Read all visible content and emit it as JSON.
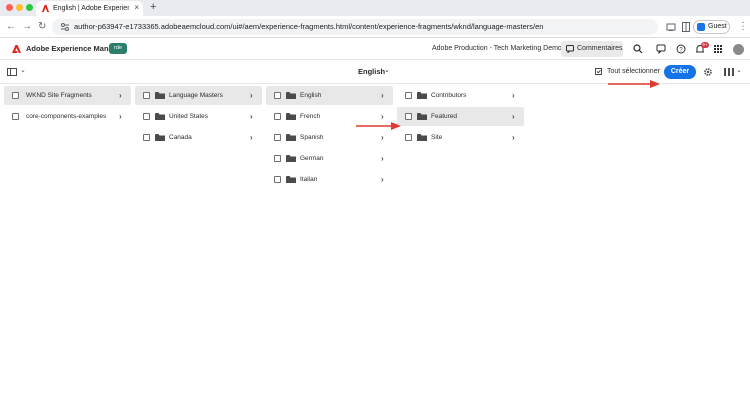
{
  "browser": {
    "tab_title": "English | Adobe Experience M",
    "url": "author-p63947-e1733365.adobeaemcloud.com/ui#/aem/experience-fragments.html/content/experience-fragments/wknd/language-masters/en",
    "guest_label": "Guest",
    "new_tab": "+",
    "close": "×"
  },
  "header": {
    "app_name": "Adobe Experience Manager",
    "env_badge": "rde",
    "org_name": "Adobe Production - Tech Marketing Demos",
    "comments_label": "Commentaires",
    "notification_count": "9+"
  },
  "actionbar": {
    "title": "English",
    "select_all_label": "Tout sélectionner",
    "create_label": "Créer"
  },
  "columns": [
    {
      "items": [
        {
          "label": "WKND Site Fragments",
          "folder": false,
          "chevron": true,
          "active": true
        },
        {
          "label": "core-components-examples",
          "folder": false,
          "chevron": true,
          "active": false
        }
      ]
    },
    {
      "items": [
        {
          "label": "Language Masters",
          "folder": true,
          "chevron": true,
          "active": true
        },
        {
          "label": "United States",
          "folder": true,
          "chevron": true,
          "active": false
        },
        {
          "label": "Canada",
          "folder": true,
          "chevron": true,
          "active": false
        }
      ]
    },
    {
      "items": [
        {
          "label": "English",
          "folder": true,
          "chevron": true,
          "active": true
        },
        {
          "label": "French",
          "folder": true,
          "chevron": true,
          "active": false
        },
        {
          "label": "Spanish",
          "folder": true,
          "chevron": true,
          "active": false
        },
        {
          "label": "German",
          "folder": true,
          "chevron": true,
          "active": false
        },
        {
          "label": "Italian",
          "folder": true,
          "chevron": true,
          "active": false
        }
      ]
    },
    {
      "items": [
        {
          "label": "Contributors",
          "folder": true,
          "chevron": true,
          "active": false
        },
        {
          "label": "Featured",
          "folder": true,
          "chevron": true,
          "active": true
        },
        {
          "label": "Site",
          "folder": true,
          "chevron": true,
          "active": false
        }
      ]
    }
  ],
  "colors": {
    "accent": "#1473e6",
    "annotation_arrow": "#e03a2f",
    "active_row": "#e8e8e8"
  }
}
